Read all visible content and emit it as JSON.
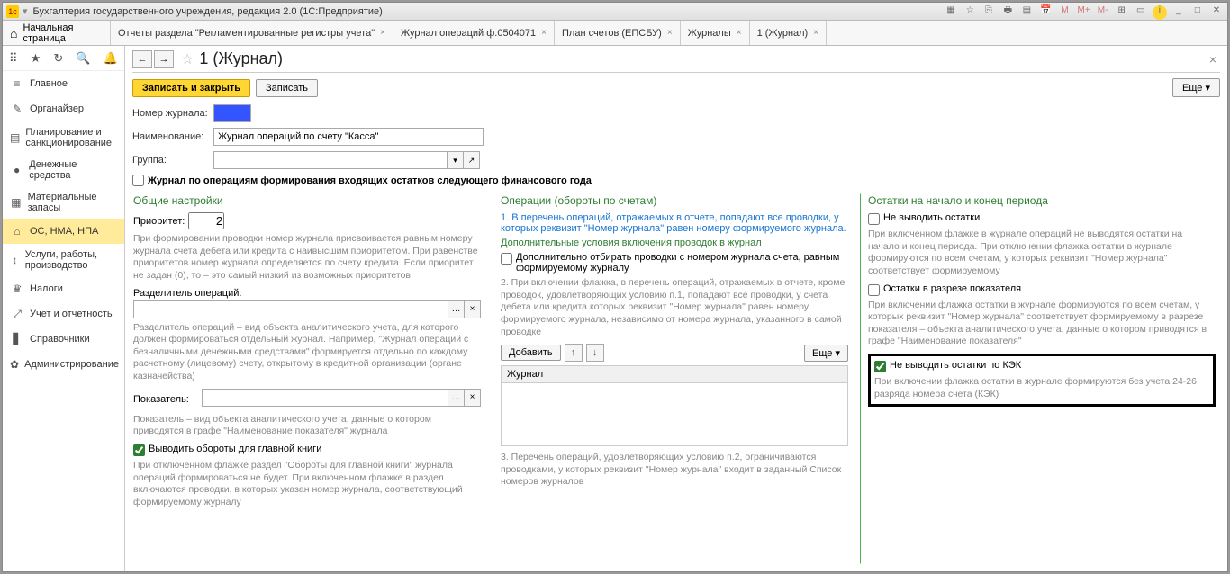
{
  "title": "Бухгалтерия государственного учреждения, редакция 2.0  (1С:Предприятие)",
  "home_label": "Начальная страница",
  "tabs": [
    {
      "label": "Отчеты раздела \"Регламентированные регистры учета\""
    },
    {
      "label": "Журнал операций ф.0504071"
    },
    {
      "label": "План счетов (ЕПСБУ)"
    },
    {
      "label": "Журналы"
    },
    {
      "label": "1 (Журнал)"
    }
  ],
  "sidebar": [
    {
      "icon": "≡",
      "label": "Главное"
    },
    {
      "icon": "✎",
      "label": "Органайзер"
    },
    {
      "icon": "▤",
      "label": "Планирование и санкционирование"
    },
    {
      "icon": "●",
      "label": "Денежные средства"
    },
    {
      "icon": "▦",
      "label": "Материальные запасы"
    },
    {
      "icon": "⌂",
      "label": "ОС, НМА, НПА"
    },
    {
      "icon": "↕",
      "label": "Услуги, работы, производство"
    },
    {
      "icon": "♛",
      "label": "Налоги"
    },
    {
      "icon": "⤢",
      "label": "Учет и отчетность"
    },
    {
      "icon": "▋",
      "label": "Справочники"
    },
    {
      "icon": "✿",
      "label": "Администрирование"
    }
  ],
  "page": {
    "title": "1 (Журнал)",
    "save_close": "Записать и закрыть",
    "save": "Записать",
    "more": "Еще",
    "num_label": "Номер журнала:",
    "name_label": "Наименование:",
    "name_value": "Журнал операций по счету \"Касса\"",
    "group_label": "Группа:",
    "flag_year": "Журнал по операциям формирования входящих остатков следующего финансового года"
  },
  "col1": {
    "title": "Общие настройки",
    "priority_label": "Приоритет:",
    "priority_value": "2",
    "help1": "При формировании проводки номер журнала присваивается равным номеру журнала счета дебета или кредита с наивысшим приоритетом. При равенстве приоритетов номер журнала определяется по счету кредита. Если приоритет не задан (0), то – это самый низкий из возможных приоритетов",
    "sep_label": "Разделитель операций:",
    "help2": "Разделитель операций – вид объекта аналитического учета, для которого должен формироваться отдельный журнал. Например, \"Журнал операций с безналичными денежными средствами\" формируется отдельно по каждому расчетному (лицевому) счету, открытому в кредитной организации (органе казначейства)",
    "ind_label": "Показатель:",
    "help3": "Показатель – вид объекта аналитического учета, данные о котором приводятся в графе \"Наименование показателя\" журнала",
    "chk_gl": "Выводить обороты для главной книги",
    "help4": "При отключенном флажке раздел \"Обороты для главной книги\" журнала операций формироваться не будет. При включенном флажке в раздел включаются проводки, в которых указан номер журнала, соответствующий формируемому журналу"
  },
  "col2": {
    "title": "Операции (обороты по счетам)",
    "blue1": "1. В перечень операций, отражаемых в отчете, попадают все проводки, у которых реквизит \"Номер журнала\" равен номеру формируемого журнала.",
    "subhead": "Дополнительные условия включения проводок в журнал",
    "chk_extra": "Дополнительно отбирать проводки с номером журнала счета, равным формируемому журналу",
    "help2": "2. При включении флажка, в перечень операций, отражаемых в отчете, кроме проводок, удовлетворяющих условию п.1, попадают все проводки, у счета дебета или кредита которых реквизит \"Номер журнала\" равен номеру формируемого журнала, независимо от номера журнала, указанного в самой проводке",
    "add": "Добавить",
    "more": "Еще",
    "list_header": "Журнал",
    "help3": "3. Перечень операций, удовлетворяющих условию п.2, ограничиваются проводками, у которых реквизит \"Номер журнала\" входит в заданный Список номеров журналов"
  },
  "col3": {
    "title": "Остатки на начало и конец периода",
    "chk1": "Не выводить остатки",
    "help1": "При включенном флажке в журнале операций не выводятся остатки на начало и конец периода. При отключении флажка остатки в журнале формируются по всем счетам, у которых реквизит \"Номер журнала\" соответствует формируемому",
    "chk2": "Остатки в разрезе показателя",
    "help2": "При включении флажка остатки в журнале формируются по всем счетам, у которых реквизит \"Номер журнала\" соответствует формируемому в разрезе показателя – объекта аналитического учета, данные о котором приводятся в графе \"Наименование показателя\"",
    "chk3": "Не выводить остатки по КЭК",
    "help3": "При включении флажка остатки в журнале формируются без учета 24-26 разряда номера счета (КЭК)"
  }
}
